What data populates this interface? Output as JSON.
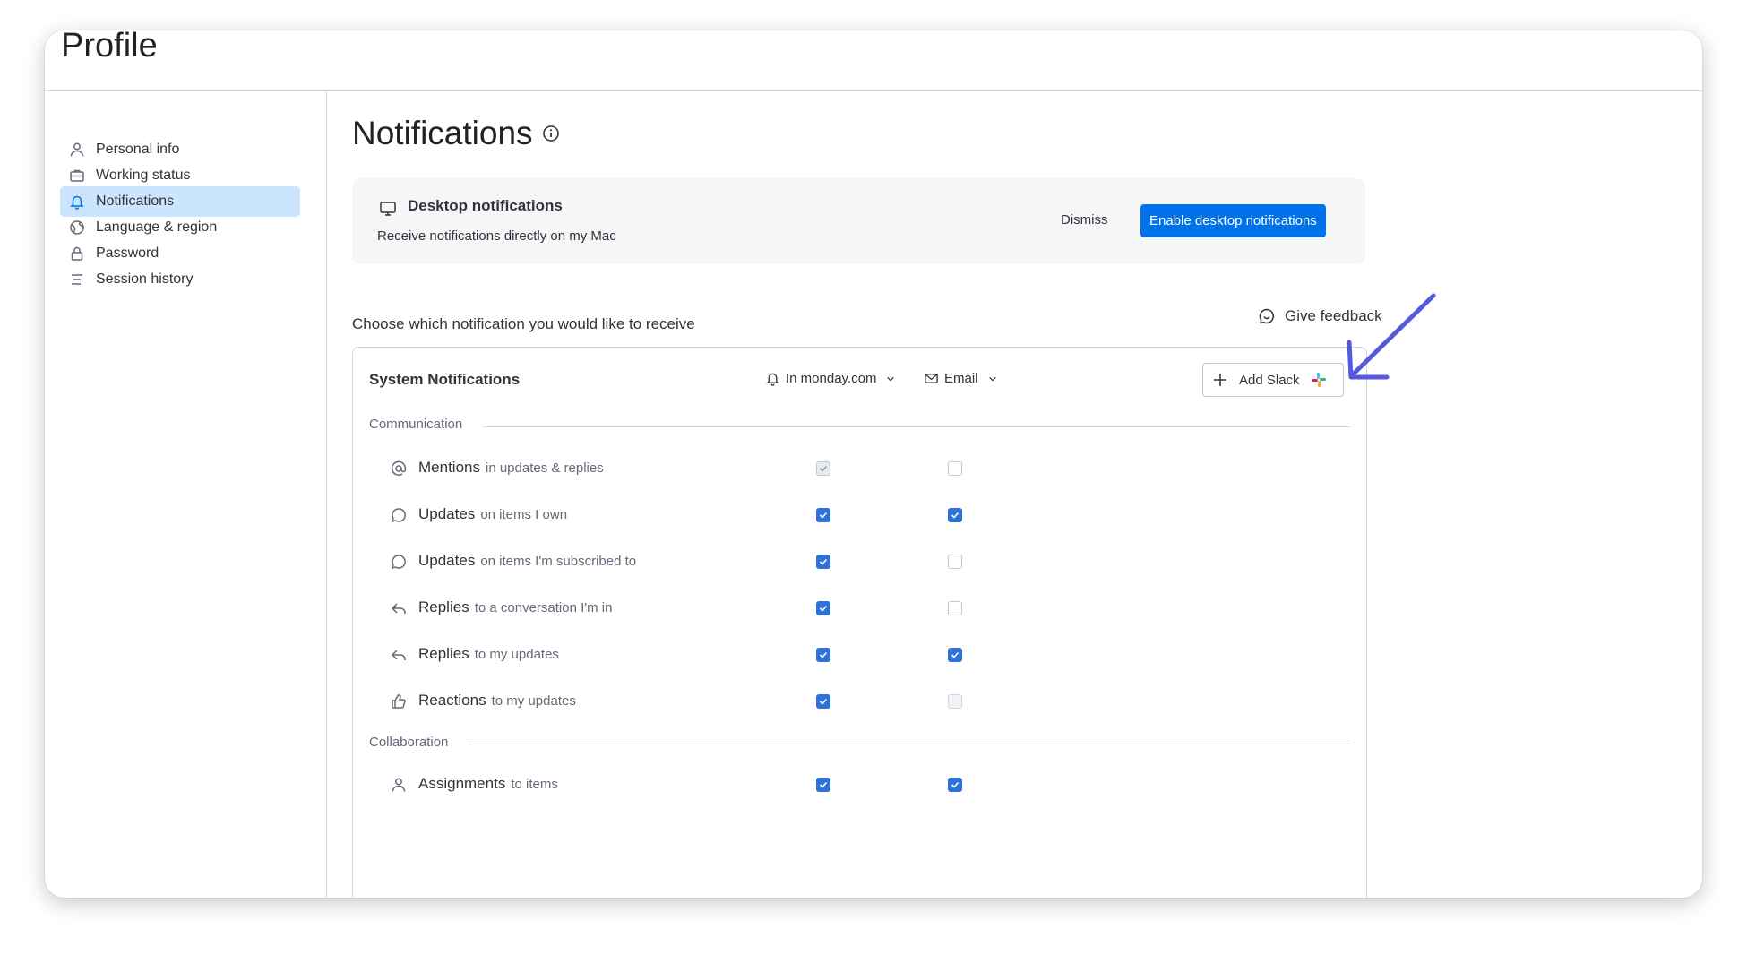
{
  "header": {
    "title": "Profile"
  },
  "sidebar": {
    "items": [
      {
        "label": "Personal info",
        "icon": "person-icon",
        "active": false
      },
      {
        "label": "Working status",
        "icon": "briefcase-icon",
        "active": false
      },
      {
        "label": "Notifications",
        "icon": "bell-icon",
        "active": true
      },
      {
        "label": "Language & region",
        "icon": "globe-icon",
        "active": false
      },
      {
        "label": "Password",
        "icon": "lock-icon",
        "active": false
      },
      {
        "label": "Session history",
        "icon": "list-icon",
        "active": false
      }
    ]
  },
  "page": {
    "title": "Notifications"
  },
  "banner": {
    "title": "Desktop notifications",
    "description": "Receive notifications directly on my Mac",
    "dismiss_label": "Dismiss",
    "enable_label": "Enable desktop notifications"
  },
  "choose_text": "Choose which notification you would like to receive",
  "feedback_label": "Give feedback",
  "system": {
    "title": "System Notifications",
    "columns": {
      "in_app": "In monday.com",
      "email": "Email",
      "slack": "Add Slack"
    }
  },
  "sections": [
    {
      "label": "Communication"
    },
    {
      "label": "Collaboration"
    }
  ],
  "rows": [
    {
      "title": "Mentions",
      "subtitle": "in updates & replies",
      "icon": "at-icon",
      "in_app": "disabled-checked",
      "email": "unchecked"
    },
    {
      "title": "Updates",
      "subtitle": "on items I own",
      "icon": "speech-bubble-icon",
      "in_app": "checked",
      "email": "checked"
    },
    {
      "title": "Updates",
      "subtitle": "on items I'm subscribed to",
      "icon": "speech-bubble-icon",
      "in_app": "checked",
      "email": "unchecked"
    },
    {
      "title": "Replies",
      "subtitle": "to a conversation I'm in",
      "icon": "reply-icon",
      "in_app": "checked",
      "email": "unchecked"
    },
    {
      "title": "Replies",
      "subtitle": "to my updates",
      "icon": "reply-icon",
      "in_app": "checked",
      "email": "checked"
    },
    {
      "title": "Reactions",
      "subtitle": "to my updates",
      "icon": "thumbs-up-icon",
      "in_app": "checked",
      "email": "disabled"
    },
    {
      "title": "Assignments",
      "subtitle": "to items",
      "icon": "person-icon",
      "in_app": "checked",
      "email": "checked"
    }
  ],
  "colors": {
    "accent": "#0073ea",
    "checkbox": "#2d72d9",
    "active_nav": "#cce5ff",
    "annotation_arrow": "#5559df"
  }
}
